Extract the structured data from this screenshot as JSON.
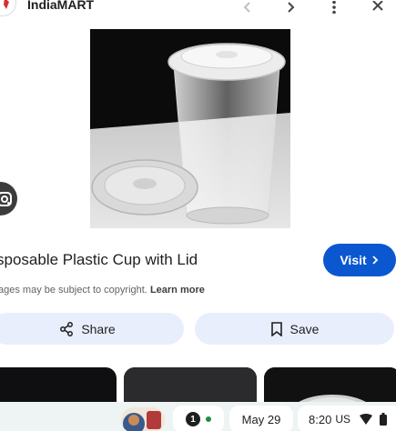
{
  "header": {
    "site_name": "IndiaMART",
    "icons": [
      "back-icon",
      "forward-icon",
      "more-vert-icon",
      "close-icon"
    ]
  },
  "image": {
    "subject": "clear plastic cup with lid"
  },
  "result": {
    "title": "sposable Plastic Cup with Lid",
    "visit_label": "Visit",
    "copyright_text": "ages may be subject to copyright.",
    "learn_more": "Learn more"
  },
  "actions": {
    "share_label": "Share",
    "save_label": "Save"
  },
  "taskbar": {
    "notification_count": "1",
    "date": "May 29",
    "time": "8:20",
    "locale": "US"
  },
  "colors": {
    "accent": "#0b57d0",
    "button_bg": "#e8eefc",
    "taskbar_bg": "#eef3f4"
  }
}
